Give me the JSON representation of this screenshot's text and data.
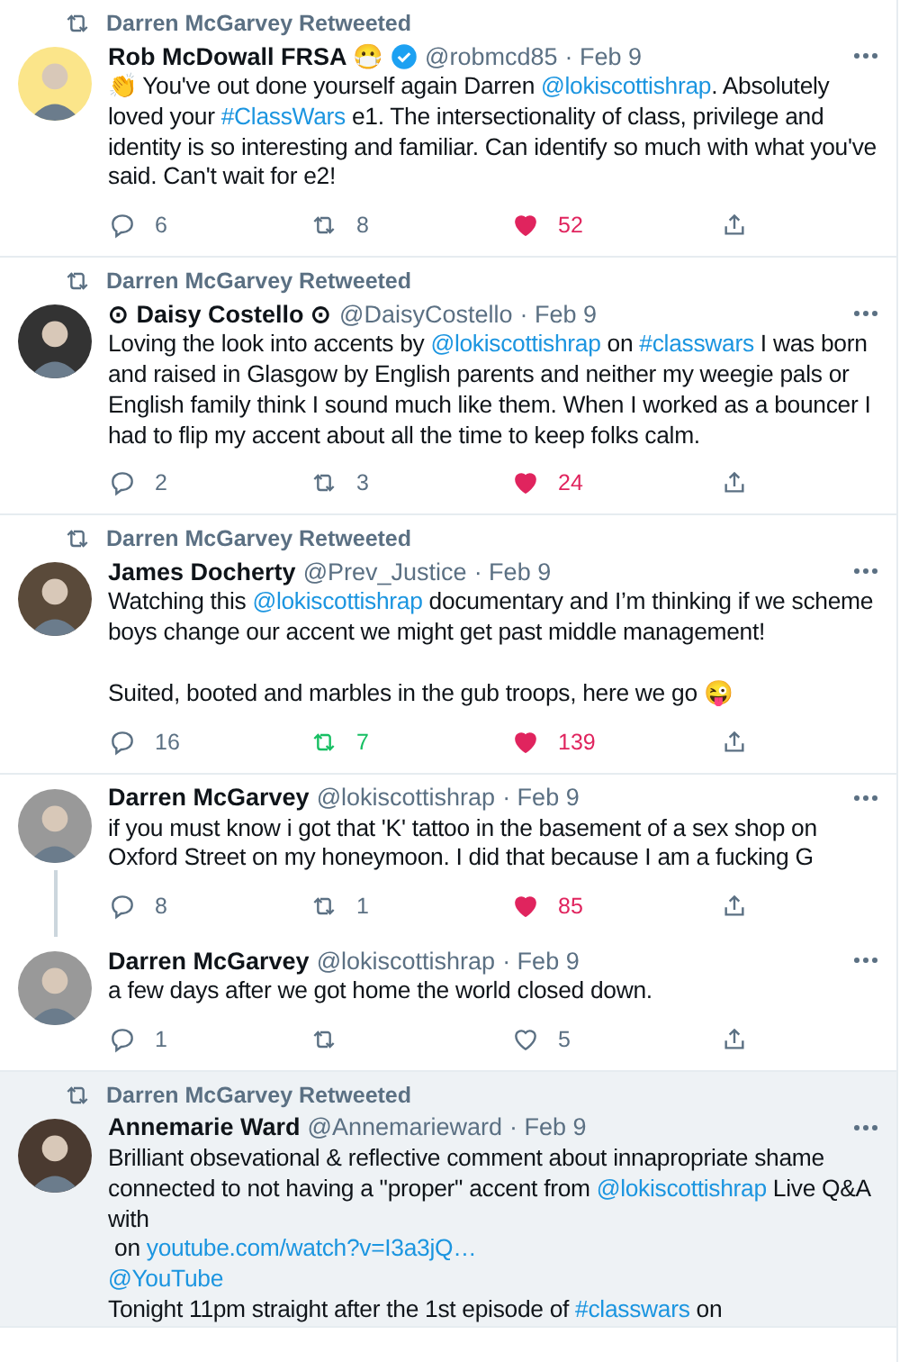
{
  "tweets": [
    {
      "retweeted_by": "Darren McGarvey Retweeted",
      "name": "Rob McDowall FRSA 😷",
      "verified": true,
      "handle": "@robmcd85",
      "date": "· Feb 9",
      "body": [
        {
          "kind": "text",
          "text": "👏 You've out done yourself again Darren "
        },
        {
          "kind": "link",
          "text": "@lokiscottishrap"
        },
        {
          "kind": "text",
          "text": ". Absolutely loved your "
        },
        {
          "kind": "link",
          "text": "#ClassWars"
        },
        {
          "kind": "text",
          "text": " e1. The intersectionality of class, privilege and identity is so interesting and familiar. Can identify so much with what you've said. Can't wait for e2!"
        }
      ],
      "actions": {
        "replies": "6",
        "retweets": "8",
        "retweeted": false,
        "likes": "52",
        "liked": true
      },
      "thread_continues": false,
      "highlighted": false
    },
    {
      "retweeted_by": "Darren McGarvey Retweeted",
      "name": "⊙ Daisy Costello ⊙",
      "verified": false,
      "handle": "@DaisyCostello",
      "date": "· Feb 9",
      "body": [
        {
          "kind": "text",
          "text": "Loving the look into accents by "
        },
        {
          "kind": "link",
          "text": "@lokiscottishrap"
        },
        {
          "kind": "text",
          "text": " on "
        },
        {
          "kind": "link",
          "text": "#classwars"
        },
        {
          "kind": "text",
          "text": " I was born and raised in Glasgow by English parents and neither my weegie pals or English family think I sound much like them. When I worked as a bouncer I had to flip my accent about all the time to keep folks calm."
        }
      ],
      "actions": {
        "replies": "2",
        "retweets": "3",
        "retweeted": false,
        "likes": "24",
        "liked": true
      },
      "thread_continues": false,
      "highlighted": false
    },
    {
      "retweeted_by": "Darren McGarvey Retweeted",
      "name": "James Docherty",
      "verified": false,
      "handle": "@Prev_Justice",
      "date": "· Feb 9",
      "body": [
        {
          "kind": "text",
          "text": "Watching this "
        },
        {
          "kind": "link",
          "text": "@lokiscottishrap"
        },
        {
          "kind": "text",
          "text": " documentary and I’m thinking if we scheme boys change our accent we might get past middle management!\n\nSuited, booted and marbles in the gub troops, here we go 😜"
        }
      ],
      "actions": {
        "replies": "16",
        "retweets": "7",
        "retweeted": true,
        "likes": "139",
        "liked": true
      },
      "thread_continues": false,
      "highlighted": false
    },
    {
      "name": "Darren McGarvey",
      "verified": false,
      "handle": "@lokiscottishrap",
      "date": "· Feb 9",
      "body": [
        {
          "kind": "text",
          "text": "if you must know i got that 'K' tattoo in the basement of a sex shop on Oxford Street on my honeymoon. I did that because I am a fucking G"
        }
      ],
      "actions": {
        "replies": "8",
        "retweets": "1",
        "retweeted": false,
        "likes": "85",
        "liked": true
      },
      "thread_continues": true,
      "highlighted": false
    },
    {
      "name": "Darren McGarvey",
      "verified": false,
      "handle": "@lokiscottishrap",
      "date": "· Feb 9",
      "body": [
        {
          "kind": "text",
          "text": "a few days after we got home the world closed down."
        }
      ],
      "actions": {
        "replies": "1",
        "retweeted": false,
        "likes": "5",
        "liked": false
      },
      "thread_continues": false,
      "highlighted": false
    },
    {
      "retweeted_by": "Darren McGarvey Retweeted",
      "name": "Annemarie Ward",
      "verified": false,
      "handle": "@Annemarieward",
      "date": "· Feb 9",
      "body": [
        {
          "kind": "text",
          "text": "Brilliant obsevational & reflective comment about innapropriate shame connected to not having a \"proper\" accent from "
        },
        {
          "kind": "link",
          "text": "@lokiscottishrap"
        },
        {
          "kind": "text",
          "text": " Live Q&A with\n on "
        },
        {
          "kind": "link",
          "text": "youtube.com/watch?v=I3a3jQ…"
        },
        {
          "kind": "break"
        },
        {
          "kind": "link",
          "text": "@YouTube"
        },
        {
          "kind": "text",
          "text": "\nTonight 11pm straight after the 1st episode of "
        },
        {
          "kind": "link",
          "text": "#classwars"
        },
        {
          "kind": "text",
          "text": " on"
        }
      ],
      "thread_continues": false,
      "highlighted": true
    }
  ]
}
